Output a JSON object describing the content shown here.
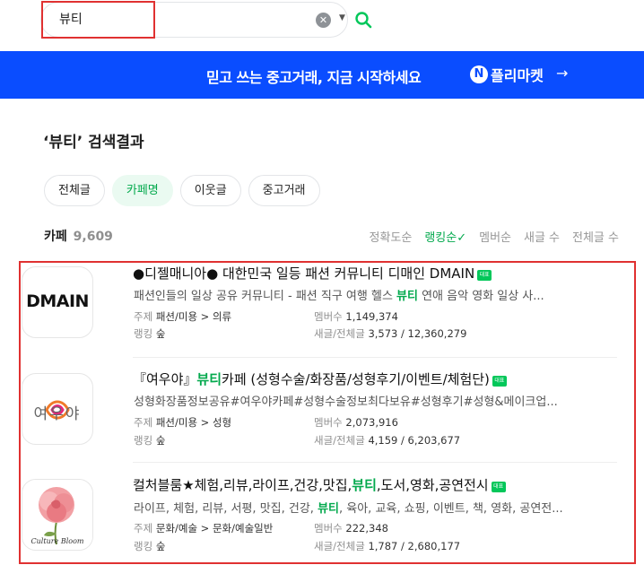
{
  "search": {
    "value": "뷰티"
  },
  "banner": {
    "text": "믿고 쓰는 중고거래, 지금 시작하세요",
    "brand_badge": "N",
    "brand": "플리마켓",
    "arrow": "→"
  },
  "result_title": "‘뷰티’ 검색결과",
  "filters": [
    "전체글",
    "카페명",
    "이웃글",
    "중고거래"
  ],
  "count": {
    "label": "카페",
    "value": "9,609"
  },
  "sorts": [
    "정확도순",
    "랭킹순✓",
    "멤버순",
    "새글 수",
    "전체글 수"
  ],
  "cafes": [
    {
      "name": "●디젤매니아● 대한민국 일등 패션 커뮤니티 디매인 DMAIN",
      "name_hl": "",
      "name_after": "",
      "badge": "대표",
      "desc_pre": "패션인들의 일상 공유 커뮤니티 - 패션 직구 여행 헬스 ",
      "desc_hl": "뷰티",
      "desc_post": " 연애 음악 영화 일상 사...",
      "topic_label": "주제",
      "topic": "패션/미용 > 의류",
      "rank_label": "랭킹",
      "rank": "숲",
      "members_label": "멤버수",
      "members": "1,149,374",
      "posts_label": "새글/전체글",
      "posts": "3,573 / 12,360,279",
      "logo_text": "DMAIN"
    },
    {
      "name": "『여우야』",
      "name_hl": "뷰티",
      "name_after": "카페 (성형수술/화장품/성형후기/이벤트/체험단)",
      "badge": "대표",
      "desc_pre": "성형화장품정보공유#여우야카페#성형수술정보최다보유#성형후기#성형&메이크업...",
      "desc_hl": "",
      "desc_post": "",
      "topic_label": "주제",
      "topic": "패션/미용 > 성형",
      "rank_label": "랭킹",
      "rank": "숲",
      "members_label": "멤버수",
      "members": "2,073,916",
      "posts_label": "새글/전체글",
      "posts": "4,159 / 6,203,677",
      "logo_text": "여우야"
    },
    {
      "name": "컬처블룸★체험,리뷰,라이프,건강,맛집,",
      "name_hl": "뷰티",
      "name_after": ",도서,영화,공연전시",
      "badge": "대표",
      "desc_pre": "라이프, 체험, 리뷰, 서평, 맛집, 건강, ",
      "desc_hl": "뷰티",
      "desc_post": ", 육아, 교육, 쇼핑, 이벤트, 책, 영화, 공연전...",
      "topic_label": "주제",
      "topic": "문화/예술 > 문화/예술일반",
      "rank_label": "랭킹",
      "rank": "숲",
      "members_label": "멤버수",
      "members": "222,348",
      "posts_label": "새글/전체글",
      "posts": "1,787 / 2,680,177",
      "logo_text": "Culture Bloom"
    }
  ]
}
